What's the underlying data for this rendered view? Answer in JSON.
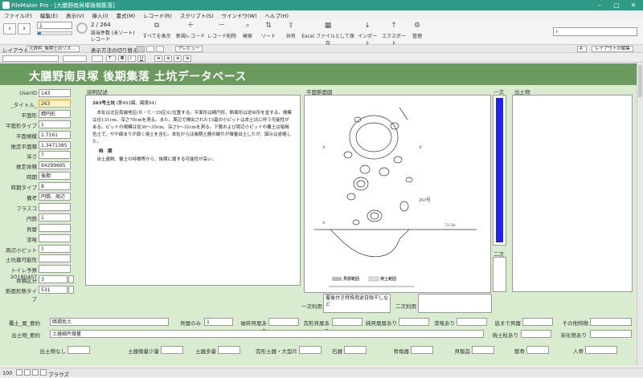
{
  "titlebar": {
    "title": "FileMaker Pro - [大膳野南貝塚後期集落]"
  },
  "menu": [
    "ファイル(F)",
    "編集(E)",
    "表示(V)",
    "挿入(I)",
    "書式(M)",
    "レコード(R)",
    "スクリプト(S)",
    "ウインドウ(W)",
    "ヘルプ(H)"
  ],
  "toolbar": {
    "record_current": "1",
    "record_total": "2 / 264",
    "record_found": "該当件数 (未ソート)",
    "record_label": "レコード",
    "show_all": "すべてを表示",
    "new_record": "新規レコード",
    "delete_record": "レコード削除",
    "find": "検索",
    "sort": "ソート",
    "share": "共有",
    "save_excel": "Excel ファイルとして保存",
    "import": "インポート",
    "export": "エクスポート",
    "manage": "管理"
  },
  "layoutbar": {
    "layout_label": "レイアウト:",
    "layout_value": "元資料_後期土坑リス...",
    "view_label": "表示方法の切り替え:",
    "preview": "プレビュー",
    "edit_layout": "レイアウトの編集"
  },
  "header": {
    "title": "大膳野南貝塚 後期集落 土坑データベース"
  },
  "left_fields": [
    {
      "label": "UserID",
      "value": "143"
    },
    {
      "label": "_タイトル_",
      "value": "263"
    },
    {
      "label": "平面形",
      "value": "精円形"
    },
    {
      "label": "平面形タイプ",
      "value": "1"
    },
    {
      "label": "平面規模",
      "value": "1.7161"
    },
    {
      "label": "推定平面積",
      "value": "1.3471385"
    },
    {
      "label": "深さ",
      "value": "7"
    },
    {
      "label": "推定体積",
      "value": "94299695"
    },
    {
      "label": "時期",
      "value": "後期"
    },
    {
      "label": "時期タイプ",
      "value": "8"
    },
    {
      "label": "備考",
      "value": "円筒、周辺"
    },
    {
      "label": "フラスコ",
      "value": ""
    },
    {
      "label": "円筒",
      "value": "1"
    },
    {
      "label": "貝層",
      "value": ""
    },
    {
      "label": "漆喰",
      "value": ""
    },
    {
      "label": "周辺小ピット",
      "value": "1"
    },
    {
      "label": "土坑墓可能性",
      "value": ""
    },
    {
      "label": "トイレ予察 20180407",
      "value": ""
    },
    {
      "label": "体積区分",
      "value": "3"
    },
    {
      "label": "断面形態タイプ",
      "value": "531"
    }
  ],
  "description": {
    "label": "説明記述",
    "heading": "263号土坑",
    "heading_note": "(第483図、図版94)",
    "body": "本址は北区南端地区(Ｂ・Ｃ－29区)に位置する。平面形は精円形、断面形は逆台形を呈する。規模は径131cm、深さ70cmを測る。また、周辺で検出された15基の小ピットは本土坑に伴う可能性がある。ピットの規模は径30～35cm、深さ5～32cmを測る。下層および周辺小ピットの覆土は暗褐色土で、やや締まりが弱く焼土を含む。本址からは後期土器の破片が微量出土したが、図示は省略した。",
    "subhead": "時　期",
    "subbody": "出土遺物、覆土の特徴等から、後期に属する可能性が高い。"
  },
  "plan": {
    "label": "平面断面図",
    "number_label": "263号",
    "marker_a": "A",
    "marker_a2": "A'",
    "elevation": "51.5m",
    "legend_1": "貝層範囲",
    "legend_2": "焼土範囲"
  },
  "primary_label": "一次",
  "secondary_label": "二次",
  "artifacts_label": "出土物",
  "primary_use": {
    "label": "一次利用",
    "value": "覆後付き特殊用途日陰干しなど"
  },
  "secondary_use": {
    "label": "二次利用",
    "value": ""
  },
  "bottom": {
    "covering_label": "覆土_層_要約",
    "covering_value": "暗褐色土",
    "shell_only_label": "貝層のみ",
    "shell_only_value": "1",
    "broken_shell_label": "破砕貝層あり",
    "complete_shell_label": "完形貝層あり",
    "mixed_shell_label": "純貝層層あり",
    "plaster_label": "漆喰あり",
    "floor_shell_label": "底まで貝層",
    "other_label": "その他特徴",
    "artifacts_sum_label": "出土物_要約",
    "artifacts_sum_value": "土器細片微量",
    "burnt_soil_label": "焼土粒あり",
    "charcoal_label": "炭化物あり",
    "none_label": "出土物なし",
    "pottery_small_label": "土器微量少量",
    "pottery_many_label": "土器多量",
    "complete_pottery_label": "完形土器・大型片",
    "stone_label": "石器",
    "bone_label": "骨角器",
    "shell_product_label": "貝製品",
    "animal_bone_label": "獣骨",
    "human_bone_label": "人骨"
  },
  "status": {
    "zoom": "100",
    "mode": "ブラウズ"
  }
}
